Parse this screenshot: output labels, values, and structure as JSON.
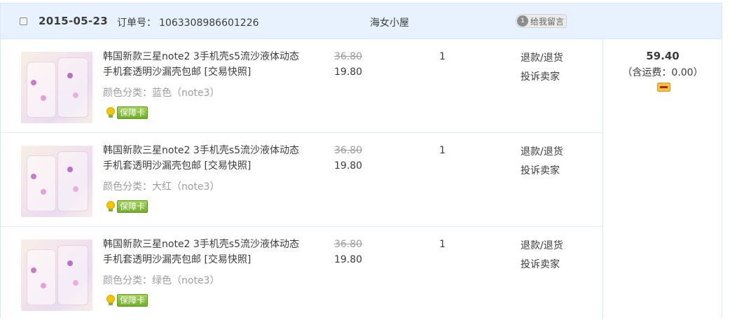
{
  "order": {
    "date": "2015-05-23",
    "order_label": "订单号：",
    "order_number": "1063308986601226",
    "shop_name": "海女小屋",
    "message_button": "给我留言",
    "message_badge": "1",
    "total": {
      "amount": "59.40",
      "shipping": "（含运费：0.00）",
      "icon": "card-icon"
    }
  },
  "items": [
    {
      "title": "韩国新款三星note2 3手机壳s5流沙液体动态手机套透明沙漏壳包邮 [交易快照]",
      "sku": "颜色分类：蓝色（note3）",
      "badge": "保障卡",
      "original_price": "36.80",
      "price": "19.80",
      "quantity": "1",
      "action_refund": "退款/退货",
      "action_complain": "投诉卖家"
    },
    {
      "title": "韩国新款三星note2 3手机壳s5流沙液体动态手机套透明沙漏壳包邮 [交易快照]",
      "sku": "颜色分类：大红（note3）",
      "badge": "保障卡",
      "original_price": "36.80",
      "price": "19.80",
      "quantity": "1",
      "action_refund": "退款/退货",
      "action_complain": "投诉卖家"
    },
    {
      "title": "韩国新款三星note2 3手机壳s5流沙液体动态手机套透明沙漏壳包邮 [交易快照]",
      "sku": "颜色分类：绿色（note3）",
      "badge": "保障卡",
      "original_price": "36.80",
      "price": "19.80",
      "quantity": "1",
      "action_refund": "退款/退货",
      "action_complain": "投诉卖家"
    }
  ]
}
